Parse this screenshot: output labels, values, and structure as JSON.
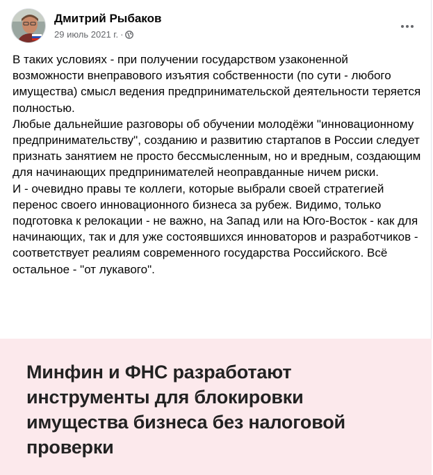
{
  "post": {
    "author": "Дмитрий Рыбаков",
    "date": "29 июль 2021 г.",
    "separator": "·",
    "audience_icon": "globe-icon",
    "more_icon": "more-horizontal-icon",
    "paragraphs": [
      "В таких условиях - при получении государством узаконенной возможности внеправового изъятия собственности (по сути - любого имущества) смысл ведения предпринимательской деятельности теряется полностью.",
      "Любые дальнейшие разговоры об обучении молодёжи \"инновационному предпринимательству\", созданию и развитию стартапов в России следует признать занятием не просто бессмысленным, но и вредным, создающим для начинающих предпринимателей неоправданные ничем риски.",
      "И - очевидно правы те коллеги, которые выбрали своей стратегией перенос своего инновационного бизнеса за рубеж. Видимо, только подготовка к релокации - не важно, на Запад или на Юго-Восток - как для начинающих, так и для уже состоявшихся инноваторов и разработчиков - соответствует реалиям современного государства Российского. Всё остальное - \"от лукавого\"."
    ]
  },
  "link_preview": {
    "headline": "Минфин и ФНС разработают инструменты для блокировки имущества бизнеса без налоговой проверки",
    "background_color": "#fce9ec"
  },
  "colors": {
    "text_primary": "#050505",
    "text_secondary": "#65676b"
  }
}
